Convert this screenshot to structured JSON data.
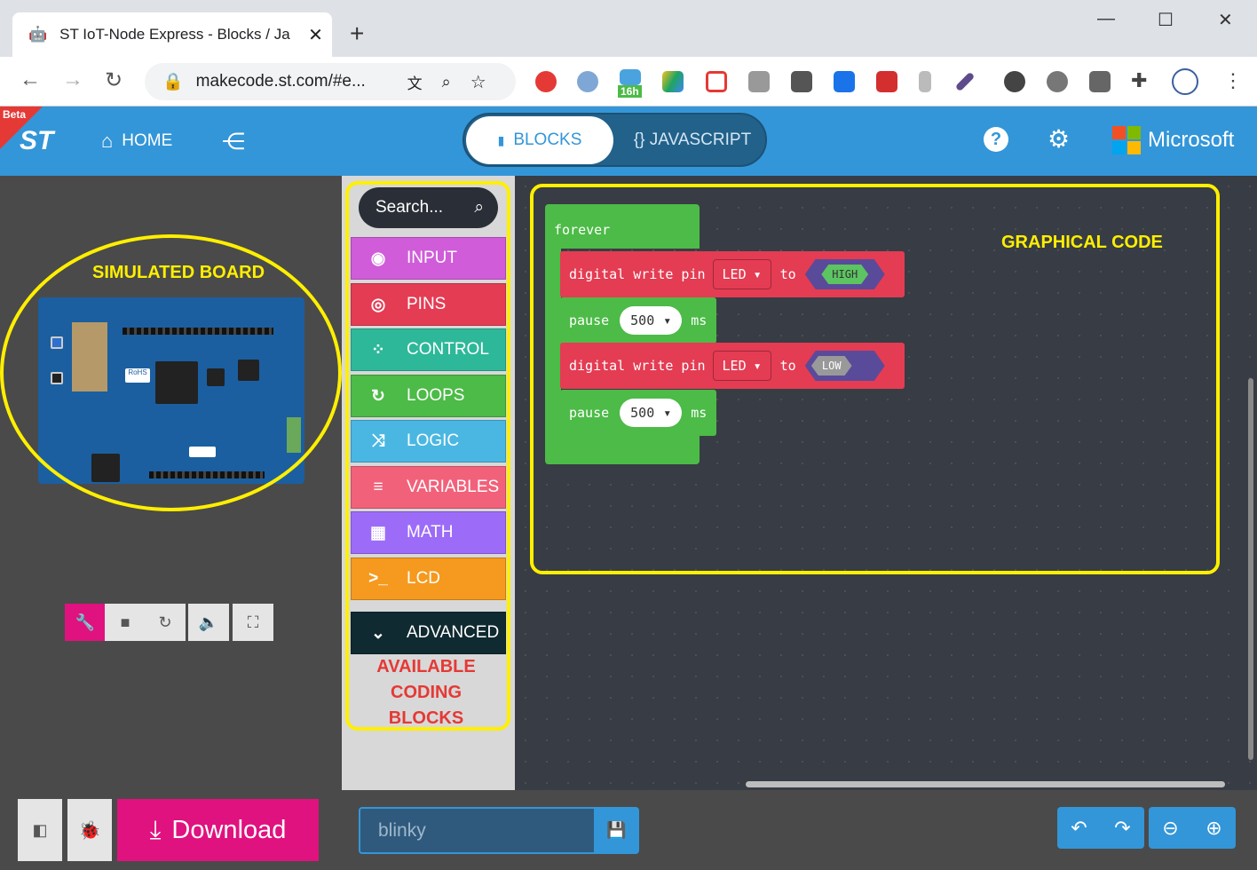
{
  "browser": {
    "tab_title": "ST IoT-Node Express - Blocks / Ja",
    "tab_close": "✕",
    "new_tab": "+",
    "url": "makecode.st.com/#e...",
    "badge_16h": "16h"
  },
  "header": {
    "beta": "Beta",
    "logo": "ST",
    "home_label": "HOME",
    "blocks_label": "BLOCKS",
    "javascript_label": "{} JAVASCRIPT",
    "brand": "Microsoft"
  },
  "simulator": {
    "annotation": "SIMULATED BOARD",
    "board_text": "RoHS"
  },
  "toolbox": {
    "search_placeholder": "Search...",
    "categories": [
      {
        "label": "INPUT",
        "color": "#d05cd9",
        "icon": "◉"
      },
      {
        "label": "PINS",
        "color": "#e43c53",
        "icon": "◎"
      },
      {
        "label": "CONTROL",
        "color": "#2eb89a",
        "icon": "⁘"
      },
      {
        "label": "LOOPS",
        "color": "#4cbb47",
        "icon": "↻"
      },
      {
        "label": "LOGIC",
        "color": "#4ab7e2",
        "icon": "⤨"
      },
      {
        "label": "VARIABLES",
        "color": "#f2617a",
        "icon": "≡"
      },
      {
        "label": "MATH",
        "color": "#9c6cf8",
        "icon": "▦"
      },
      {
        "label": "LCD",
        "color": "#f59a1e",
        "icon": ">_"
      }
    ],
    "advanced_label": "ADVANCED",
    "annotation_lines": [
      "AVAILABLE",
      "CODING",
      "BLOCKS"
    ]
  },
  "workspace": {
    "annotation": "GRAPHICAL CODE",
    "forever_label": "forever",
    "blocks": [
      {
        "kind": "digital_write",
        "text": "digital write pin",
        "pin": "LED",
        "to": "to",
        "value": "HIGH"
      },
      {
        "kind": "pause",
        "text": "pause",
        "value": "500",
        "unit": "ms"
      },
      {
        "kind": "digital_write",
        "text": "digital write pin",
        "pin": "LED",
        "to": "to",
        "value": "LOW"
      },
      {
        "kind": "pause",
        "text": "pause",
        "value": "500",
        "unit": "ms"
      }
    ]
  },
  "footer": {
    "download_label": "Download",
    "project_name": "blinky"
  },
  "colors": {
    "accent": "#3396d8",
    "annotation": "#ffef00",
    "download": "#e0127f"
  }
}
